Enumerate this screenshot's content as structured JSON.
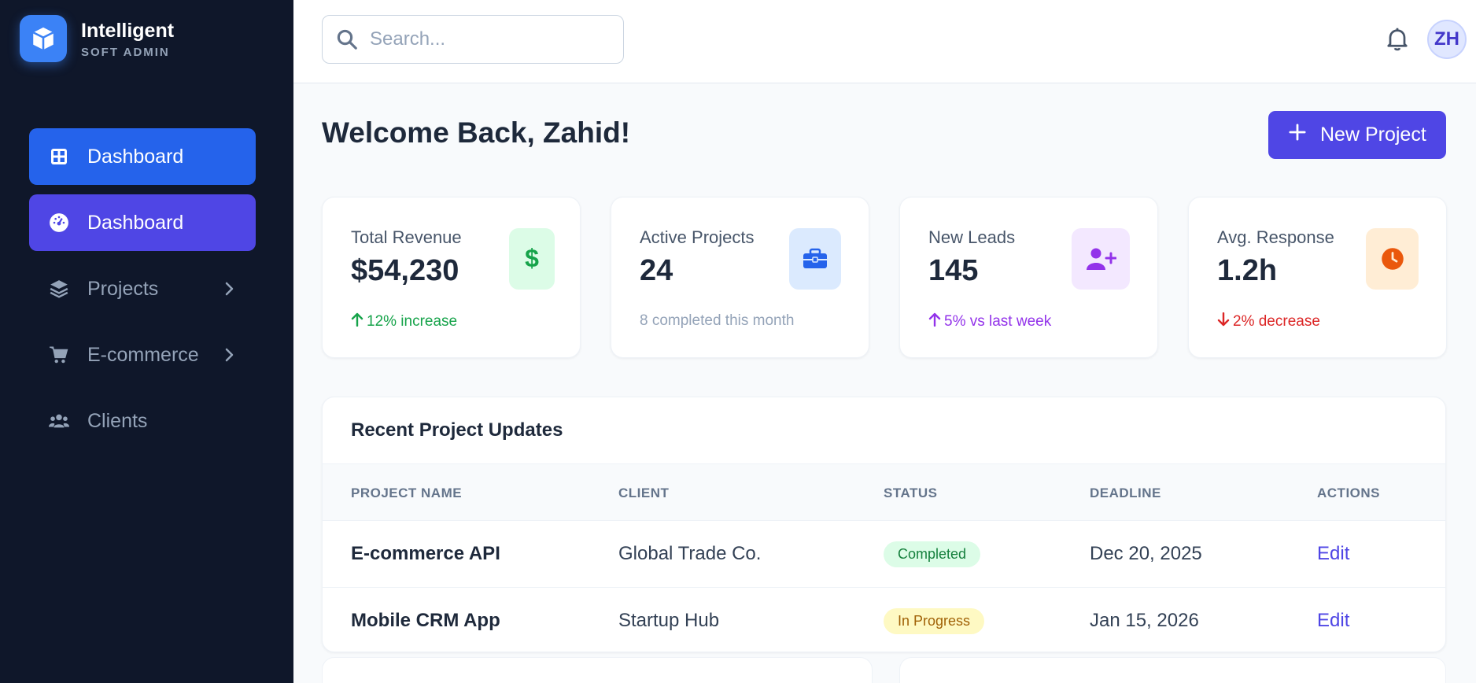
{
  "brand": {
    "name": "Intelligent",
    "subtitle": "SOFT ADMIN"
  },
  "sidebar": {
    "items": [
      {
        "label": "Dashboard",
        "icon": "grid-icon",
        "state": "active"
      },
      {
        "label": "Dashboard",
        "icon": "dashboard-gauge-icon",
        "state": "active"
      },
      {
        "label": "Projects",
        "icon": "layers-icon",
        "has_submenu": true
      },
      {
        "label": "E-commerce",
        "icon": "cart-icon",
        "has_submenu": true
      },
      {
        "label": "Clients",
        "icon": "users-icon"
      }
    ]
  },
  "topbar": {
    "search_placeholder": "Search...",
    "avatar_initials": "ZH"
  },
  "header": {
    "welcome": "Welcome Back, Zahid!",
    "new_project_label": "New Project"
  },
  "stats": [
    {
      "label": "Total Revenue",
      "value": "$54,230",
      "foot": "12% increase",
      "trend": "up",
      "icon": "dollar-icon",
      "accent": "#16a34a",
      "accent_bg": "#dcfce7"
    },
    {
      "label": "Active Projects",
      "value": "24",
      "foot": "8 completed this month",
      "trend": "none",
      "icon": "briefcase-icon",
      "accent": "#2563eb",
      "accent_bg": "#dbeafe"
    },
    {
      "label": "New Leads",
      "value": "145",
      "foot": "5% vs last week",
      "trend": "up",
      "icon": "user-plus-icon",
      "accent": "#9333ea",
      "accent_bg": "#f3e8ff"
    },
    {
      "label": "Avg. Response",
      "value": "1.2h",
      "foot": "2% decrease",
      "trend": "down",
      "icon": "clock-icon",
      "accent": "#ea580c",
      "accent_bg": "#ffedd5"
    }
  ],
  "projects_table": {
    "title": "Recent Project Updates",
    "columns": [
      "PROJECT NAME",
      "CLIENT",
      "STATUS",
      "DEADLINE",
      "ACTIONS"
    ],
    "rows": [
      {
        "name": "E-commerce API",
        "client": "Global Trade Co.",
        "status": "Completed",
        "deadline": "Dec 20, 2025",
        "action": "Edit"
      },
      {
        "name": "Mobile CRM App",
        "client": "Startup Hub",
        "status": "In Progress",
        "deadline": "Jan 15, 2026",
        "action": "Edit"
      }
    ]
  },
  "colors": {
    "sidebar_bg": "#0f172a",
    "primary_blue": "#2563eb",
    "primary_indigo": "#4f46e5",
    "completed_bg": "#dcfce7",
    "completed_text": "#15803d",
    "in_progress_bg": "#fef9c3",
    "in_progress_text": "#a16207"
  }
}
